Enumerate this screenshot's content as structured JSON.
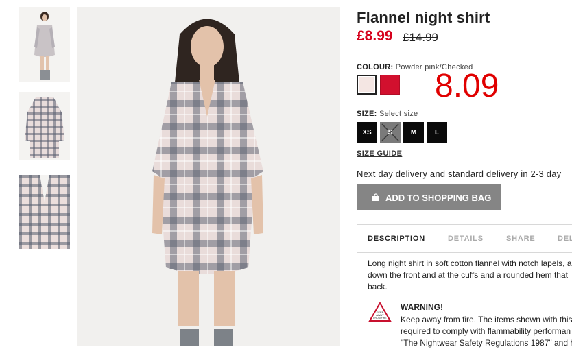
{
  "product": {
    "title": "Flannel night shirt",
    "price": "£8.99",
    "old_price": "£14.99"
  },
  "colour": {
    "label": "COLOUR:",
    "selected": "Powder pink/Checked",
    "swatches": [
      {
        "name": "Powder pink/Checked",
        "color": "#f4e6e3",
        "selected": true
      },
      {
        "name": "Red",
        "color": "#d2102e",
        "selected": false
      }
    ]
  },
  "overlay_number": "8.09",
  "size": {
    "label": "SIZE:",
    "prompt": "Select size",
    "options": [
      {
        "label": "XS",
        "available": true
      },
      {
        "label": "S",
        "available": false
      },
      {
        "label": "M",
        "available": true
      },
      {
        "label": "L",
        "available": true
      }
    ],
    "guide": "SIZE GUIDE"
  },
  "delivery": "Next day delivery and standard delivery in 2-3 day",
  "add_to_bag": "ADD TO SHOPPING BAG",
  "tabs": [
    "DESCRIPTION",
    "DETAILS",
    "SHARE",
    "DEL"
  ],
  "description": {
    "line1": "Long night shirt in soft cotton flannel with notch lapels, a",
    "line2": "down the front and at the cuffs and a rounded hem that",
    "line3": "back."
  },
  "warning": {
    "icon": "keep-away-from-fire-icon",
    "icon_text": [
      "KEEP",
      "AWAY",
      "FROM FIRE"
    ],
    "title": "WARNING!",
    "line1": "Keep away from fire. The items shown with this",
    "line2": "required to comply with flammability performan",
    "line3": "\"The Nightwear Safety Regulations 1987\" and h"
  },
  "colors": {
    "price_red": "#d6001c",
    "overlay_red": "#e00000",
    "button_grey": "#858585"
  }
}
